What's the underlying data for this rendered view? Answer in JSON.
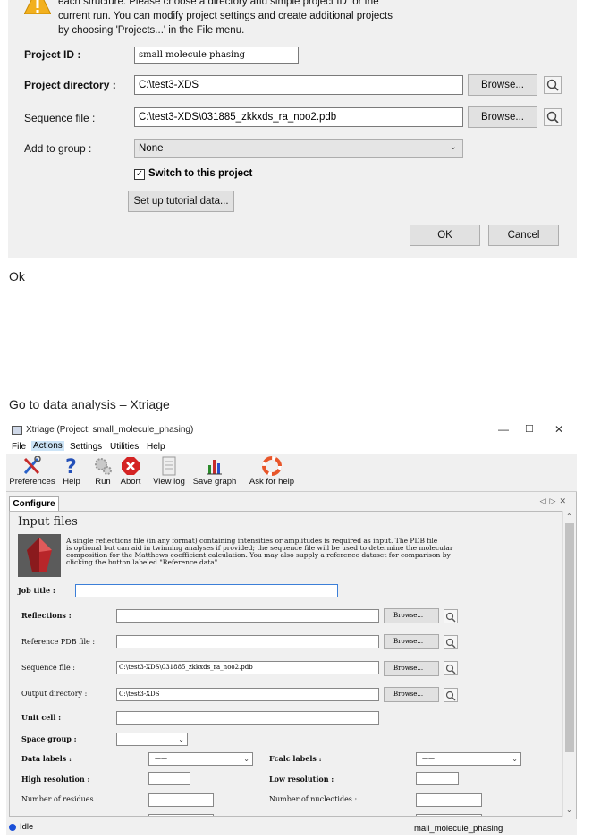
{
  "dialog": {
    "intro_text": "each structure.  Please choose a directory and simple project ID for the\ncurrent run.  You can modify project settings and create additional projects\nby choosing 'Projects...' in the File menu.",
    "project_id_label": "Project ID :",
    "project_id_value": "small molecule phasing",
    "project_dir_label": "Project directory :",
    "project_dir_value": "C:\\test3-XDS",
    "sequence_label": "Sequence file :",
    "sequence_value": "C:\\test3-XDS\\031885_zkkxds_ra_noo2.pdb",
    "group_label": "Add to group :",
    "group_value": "None",
    "browse_label": "Browse...",
    "switch_label": "Switch to this project",
    "switch_checked": true,
    "tutorial_button": "Set up tutorial data...",
    "ok_button": "OK",
    "cancel_button": "Cancel"
  },
  "text_ok": "Ok",
  "text_goto": "Go to data analysis – Xtriage",
  "xtriage": {
    "title": "Xtriage (Project: small_molecule_phasing)",
    "menu": [
      "File",
      "Actions",
      "Settings",
      "Utilities",
      "Help"
    ],
    "toolbar": {
      "preferences": "Preferences",
      "help": "Help",
      "run": "Run",
      "abort": "Abort",
      "view_log": "View log",
      "save_graph": "Save graph",
      "ask_help": "Ask for help"
    },
    "tab": "Configure",
    "section_title": "Input files",
    "description": "A single reflections file (in any format) containing intensities or amplitudes is required as input.  The PDB file\nis optional but can aid in twinning analyses if provided; the sequence file will be used to determine the molecular\ncomposition for the Matthews coefficient calculation.  You may also supply a reference dataset for comparison by\nclicking the button labeled \"Reference data\".",
    "job_title_label": "Job title :",
    "job_title_value": "",
    "reflections_label": "Reflections :",
    "reflections_value": "",
    "ref_pdb_label": "Reference PDB file :",
    "ref_pdb_value": "",
    "sequence_label": "Sequence file :",
    "sequence_value": "C:\\test3-XDS\\031885_zkkxds_ra_noo2.pdb",
    "output_dir_label": "Output directory :",
    "output_dir_value": "C:\\test3-XDS",
    "browse_label": "Browse...",
    "unit_cell_label": "Unit cell :",
    "unit_cell_value": "",
    "space_group_label": "Space group :",
    "data_labels_label": "Data labels :",
    "data_labels_value": "——",
    "fcalc_labels_label": "Fcalc labels :",
    "fcalc_labels_value": "——",
    "high_res_label": "High resolution :",
    "low_res_label": "Low resolution :",
    "n_residues_label": "Number of residues :",
    "n_nucleotides_label": "Number of nucleotides :",
    "status": "Idle",
    "status_project": "mall_molecule_phasing"
  }
}
